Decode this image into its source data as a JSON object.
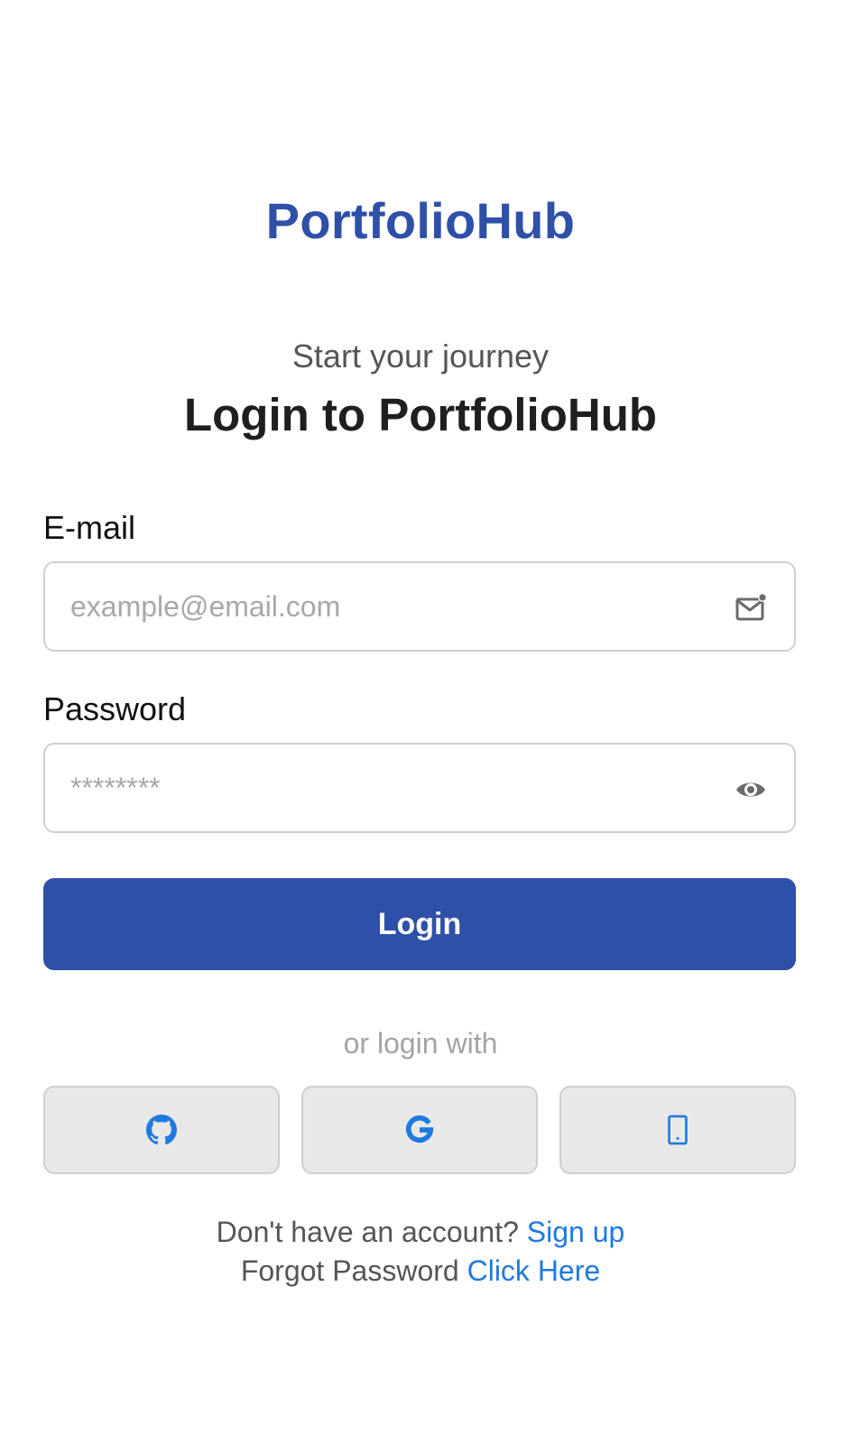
{
  "brand": "PortfolioHub",
  "header": {
    "subtitle": "Start your journey",
    "title": "Login to PortfolioHub"
  },
  "email": {
    "label": "E-mail",
    "placeholder": "example@email.com",
    "icon": "mail-icon"
  },
  "password": {
    "label": "Password",
    "placeholder": "********",
    "icon": "eye-icon"
  },
  "login_button": "Login",
  "social": {
    "divider": "or login with",
    "buttons": [
      {
        "icon": "github-icon"
      },
      {
        "icon": "google-icon"
      },
      {
        "icon": "phone-icon"
      }
    ]
  },
  "footer": {
    "signup_prompt": "Don't have an account?",
    "signup_link": "Sign up",
    "forgot_prompt": "Forgot Password",
    "forgot_link": "Click Here"
  },
  "colors": {
    "brand": "#2e50a8",
    "link": "#1f7ae0",
    "icon_blue": "#1f7ae0",
    "icon_gray": "#6b6b6b",
    "social_bg": "#e8e8e8"
  }
}
